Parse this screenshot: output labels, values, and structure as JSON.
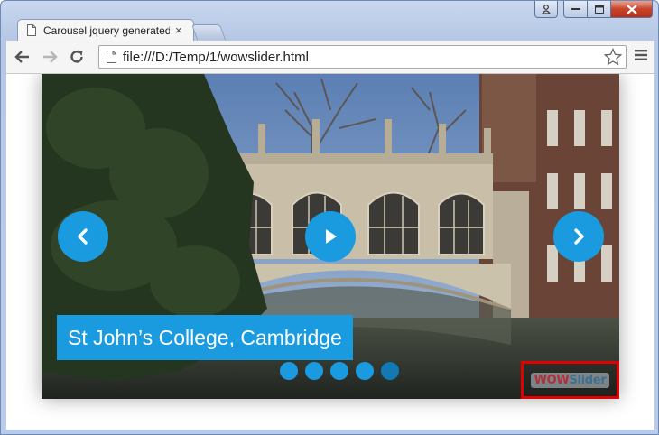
{
  "browser": {
    "tab_title": "Carousel jquery generated",
    "url": "file:///D:/Temp/1/wowslider.html",
    "tab_close_glyph": "×"
  },
  "icons": {
    "back": "back-arrow-icon",
    "forward": "forward-arrow-icon",
    "reload": "reload-icon",
    "page": "page-icon",
    "star": "bookmark-star-icon",
    "menu": "hamburger-menu-icon"
  },
  "slider": {
    "caption": "St John’s College, Cambridge",
    "bullet_count": 5,
    "active_bullet": 5,
    "logo_part1": "WOW",
    "logo_part2": "Slider"
  },
  "colors": {
    "accent": "#1a9be0",
    "badge_border": "#e30000"
  }
}
